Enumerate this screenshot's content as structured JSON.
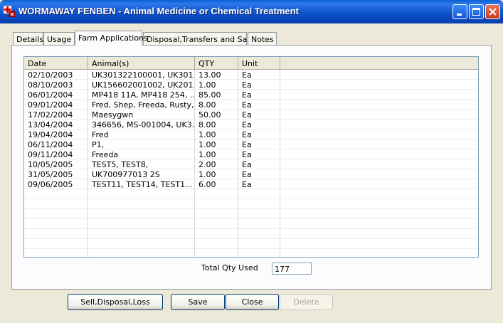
{
  "window": {
    "title": "WORMAWAY FENBEN - Animal Medicine or Chemical Treatment",
    "app_icon": "medicine-cross-icon",
    "controls": [
      "minimize-icon",
      "maximize-icon",
      "close-icon"
    ]
  },
  "tabs": [
    {
      "label": "Details",
      "active": false
    },
    {
      "label": "Usage",
      "active": false
    },
    {
      "label": "Farm Applications",
      "active": true
    },
    {
      "label": "Disposal,Transfers and Sales",
      "active": false
    },
    {
      "label": "Notes",
      "active": false
    }
  ],
  "table": {
    "columns": [
      "Date",
      "Animal(s)",
      "QTY",
      "Unit"
    ],
    "rows": [
      [
        "02/10/2003",
        "UK301322100001, UK301...",
        "13.00",
        "Ea"
      ],
      [
        "08/10/2003",
        "UK156602001002, UK201...",
        "1.00",
        "Ea"
      ],
      [
        "06/01/2004",
        "MP418 11A, MP418 254, ...",
        "85.00",
        "Ea"
      ],
      [
        "09/01/2004",
        "Fred, Shep, Freeda, Rusty,...",
        "8.00",
        "Ea"
      ],
      [
        "17/02/2004",
        "Maesygwn",
        "50.00",
        "Ea"
      ],
      [
        "13/04/2004",
        "346656, MS-001004, UK3...",
        "8.00",
        "Ea"
      ],
      [
        "19/04/2004",
        "Fred",
        "1.00",
        "Ea"
      ],
      [
        "06/11/2004",
        "P1,",
        "1.00",
        "Ea"
      ],
      [
        "09/11/2004",
        "Freeda",
        "1.00",
        "Ea"
      ],
      [
        "10/05/2005",
        "TEST5, TEST8,",
        "2.00",
        "Ea"
      ],
      [
        "31/05/2005",
        "UK700977013 2S",
        "1.00",
        "Ea"
      ],
      [
        "09/06/2005",
        "TEST11, TEST14, TEST1...",
        "6.00",
        "Ea"
      ]
    ]
  },
  "total": {
    "label": "Total Qty Used",
    "value": "177"
  },
  "buttons": {
    "sell": "Sell,Disposal,Loss",
    "save": "Save",
    "close": "Close",
    "delete": "Delete"
  }
}
